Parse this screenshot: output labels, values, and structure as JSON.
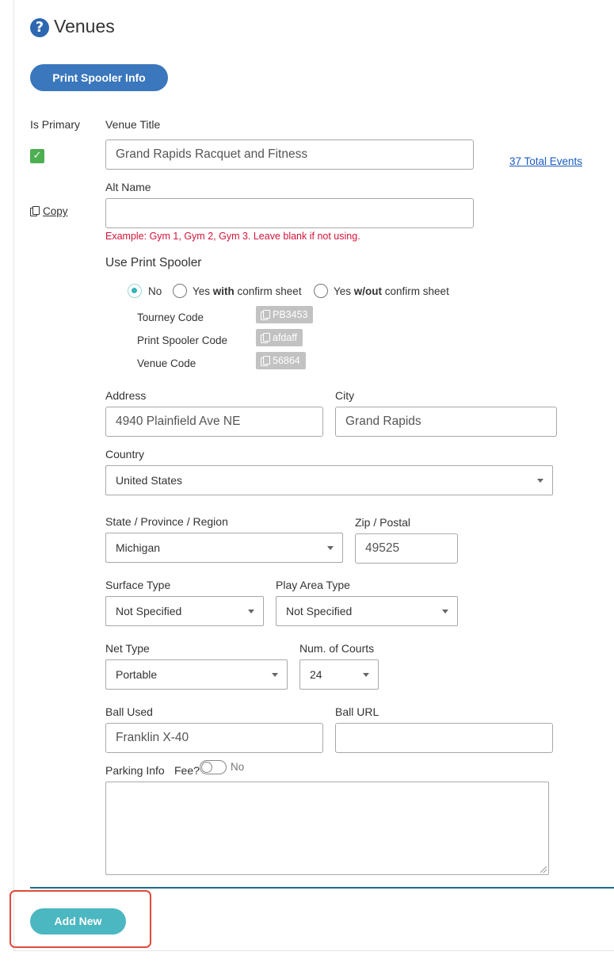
{
  "page": {
    "title": "Venues",
    "help_icon": "question-circle-icon"
  },
  "actions": {
    "print_spooler_info": "Print Spooler Info",
    "add_new": "Add New"
  },
  "venue": {
    "is_primary_label": "Is Primary",
    "is_primary_checked": true,
    "copy_label": "Copy",
    "title_label": "Venue Title",
    "title_value": "Grand Rapids Racquet and Fitness",
    "total_events_link": "37 Total Events",
    "alt_name_label": "Alt Name",
    "alt_name_value": "",
    "alt_name_hint": "Example: Gym 1, Gym 2, Gym 3. Leave blank if not using."
  },
  "print_spooler": {
    "heading": "Use Print Spooler",
    "options": [
      {
        "label": "No",
        "selected": true
      },
      {
        "label_pre": "Yes ",
        "label_bold": "with",
        "label_post": " confirm sheet",
        "selected": false
      },
      {
        "label_pre": "Yes ",
        "label_bold": "w/out",
        "label_post": " confirm sheet",
        "selected": false
      }
    ],
    "codes": [
      {
        "label": "Tourney Code",
        "value": "PB3453"
      },
      {
        "label": "Print Spooler Code",
        "value": "afdaff"
      },
      {
        "label": "Venue Code",
        "value": "56864"
      }
    ]
  },
  "address": {
    "address_label": "Address",
    "address_value": "4940 Plainfield Ave NE",
    "city_label": "City",
    "city_value": "Grand Rapids",
    "country_label": "Country",
    "country_value": "United States",
    "state_label": "State / Province / Region",
    "state_value": "Michigan",
    "zip_label": "Zip / Postal",
    "zip_value": "49525"
  },
  "details": {
    "surface_type_label": "Surface Type",
    "surface_type_value": "Not Specified",
    "play_area_label": "Play Area Type",
    "play_area_value": "Not Specified",
    "net_type_label": "Net Type",
    "net_type_value": "Portable",
    "courts_label": "Num. of Courts",
    "courts_value": "24",
    "ball_used_label": "Ball Used",
    "ball_used_value": "Franklin X-40",
    "ball_url_label": "Ball URL",
    "ball_url_value": ""
  },
  "parking": {
    "label": "Parking Info",
    "fee_label": "Fee?",
    "fee_state": "No",
    "notes": ""
  },
  "colors": {
    "primary_blue": "#3a77bd",
    "teal": "#4bb7c0",
    "check_green": "#4caf50",
    "hint_red": "#d2143a",
    "highlight": "#e04a3a"
  }
}
